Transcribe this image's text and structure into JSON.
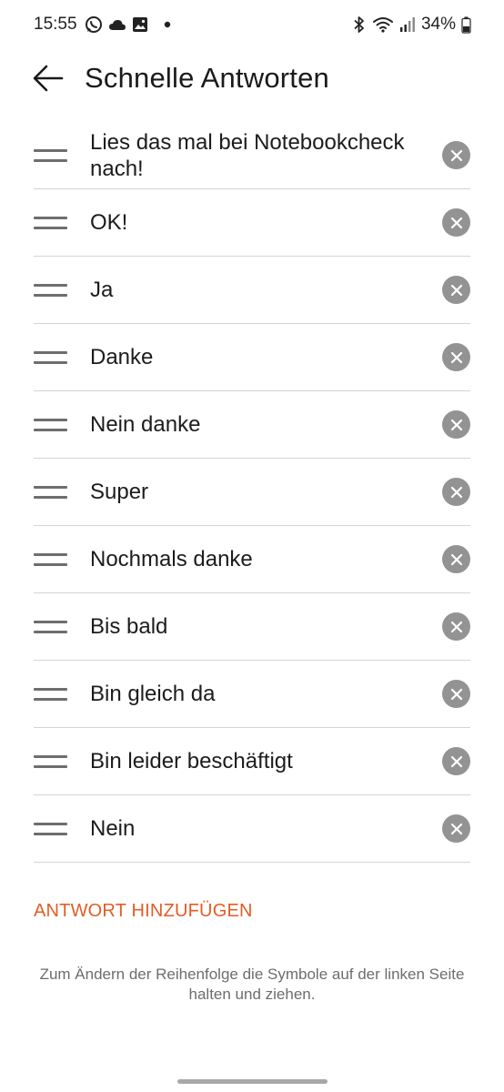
{
  "status_bar": {
    "time": "15:55",
    "icons_left": [
      "whatsapp-icon",
      "cloud-icon",
      "image-icon",
      "dot-icon"
    ],
    "icons_right": [
      "bluetooth-icon",
      "wifi-icon",
      "signal-icon",
      "battery-icon"
    ],
    "battery_percent": "34%"
  },
  "header": {
    "title": "Schnelle Antworten",
    "back_icon": "arrow-left-icon"
  },
  "replies": [
    {
      "text": "Lies das mal bei Notebookcheck nach!"
    },
    {
      "text": "OK!"
    },
    {
      "text": "Ja"
    },
    {
      "text": "Danke"
    },
    {
      "text": "Nein danke"
    },
    {
      "text": "Super"
    },
    {
      "text": "Nochmals danke"
    },
    {
      "text": "Bis bald"
    },
    {
      "text": "Bin gleich da"
    },
    {
      "text": "Bin leider beschäftigt"
    },
    {
      "text": "Nein"
    }
  ],
  "add_reply_label": "ANTWORT HINZUFÜGEN",
  "hint": "Zum Ändern der Reihenfolge die Symbole auf der linken Seite halten und ziehen.",
  "colors": {
    "accent": "#e35d25",
    "remove_button": "#939393",
    "divider": "#d4d4d4"
  }
}
